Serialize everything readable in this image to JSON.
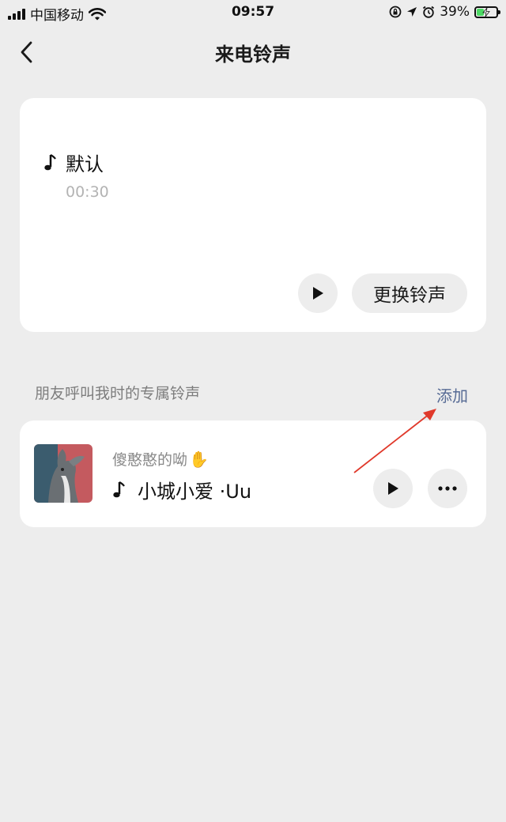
{
  "status_bar": {
    "carrier": "中国移动",
    "time": "09:57",
    "battery_percent": "39%",
    "battery_level": 0.39,
    "icons": [
      "signal-icon",
      "wifi-icon",
      "orientation-lock-icon",
      "location-icon",
      "alarm-icon",
      "battery-icon"
    ]
  },
  "nav": {
    "title": "来电铃声",
    "back_icon": "chevron-left-icon"
  },
  "default_ringtone": {
    "name": "默认",
    "duration": "00:30",
    "change_label": "更换铃声",
    "icons": [
      "music-note-icon",
      "play-icon"
    ]
  },
  "friends_section": {
    "label": "朋友呼叫我时的专属铃声",
    "add_label": "添加"
  },
  "friend_ringtone": {
    "contact_name": "傻憨憨的呦",
    "contact_emoji": "✋",
    "song_title": "小城小爱 ·Uu",
    "icons": [
      "album-art",
      "music-note-icon",
      "play-icon",
      "more-icon"
    ]
  },
  "colors": {
    "background": "#ededed",
    "card": "#ffffff",
    "link": "#576b95",
    "annotation_arrow": "#e0392b"
  }
}
